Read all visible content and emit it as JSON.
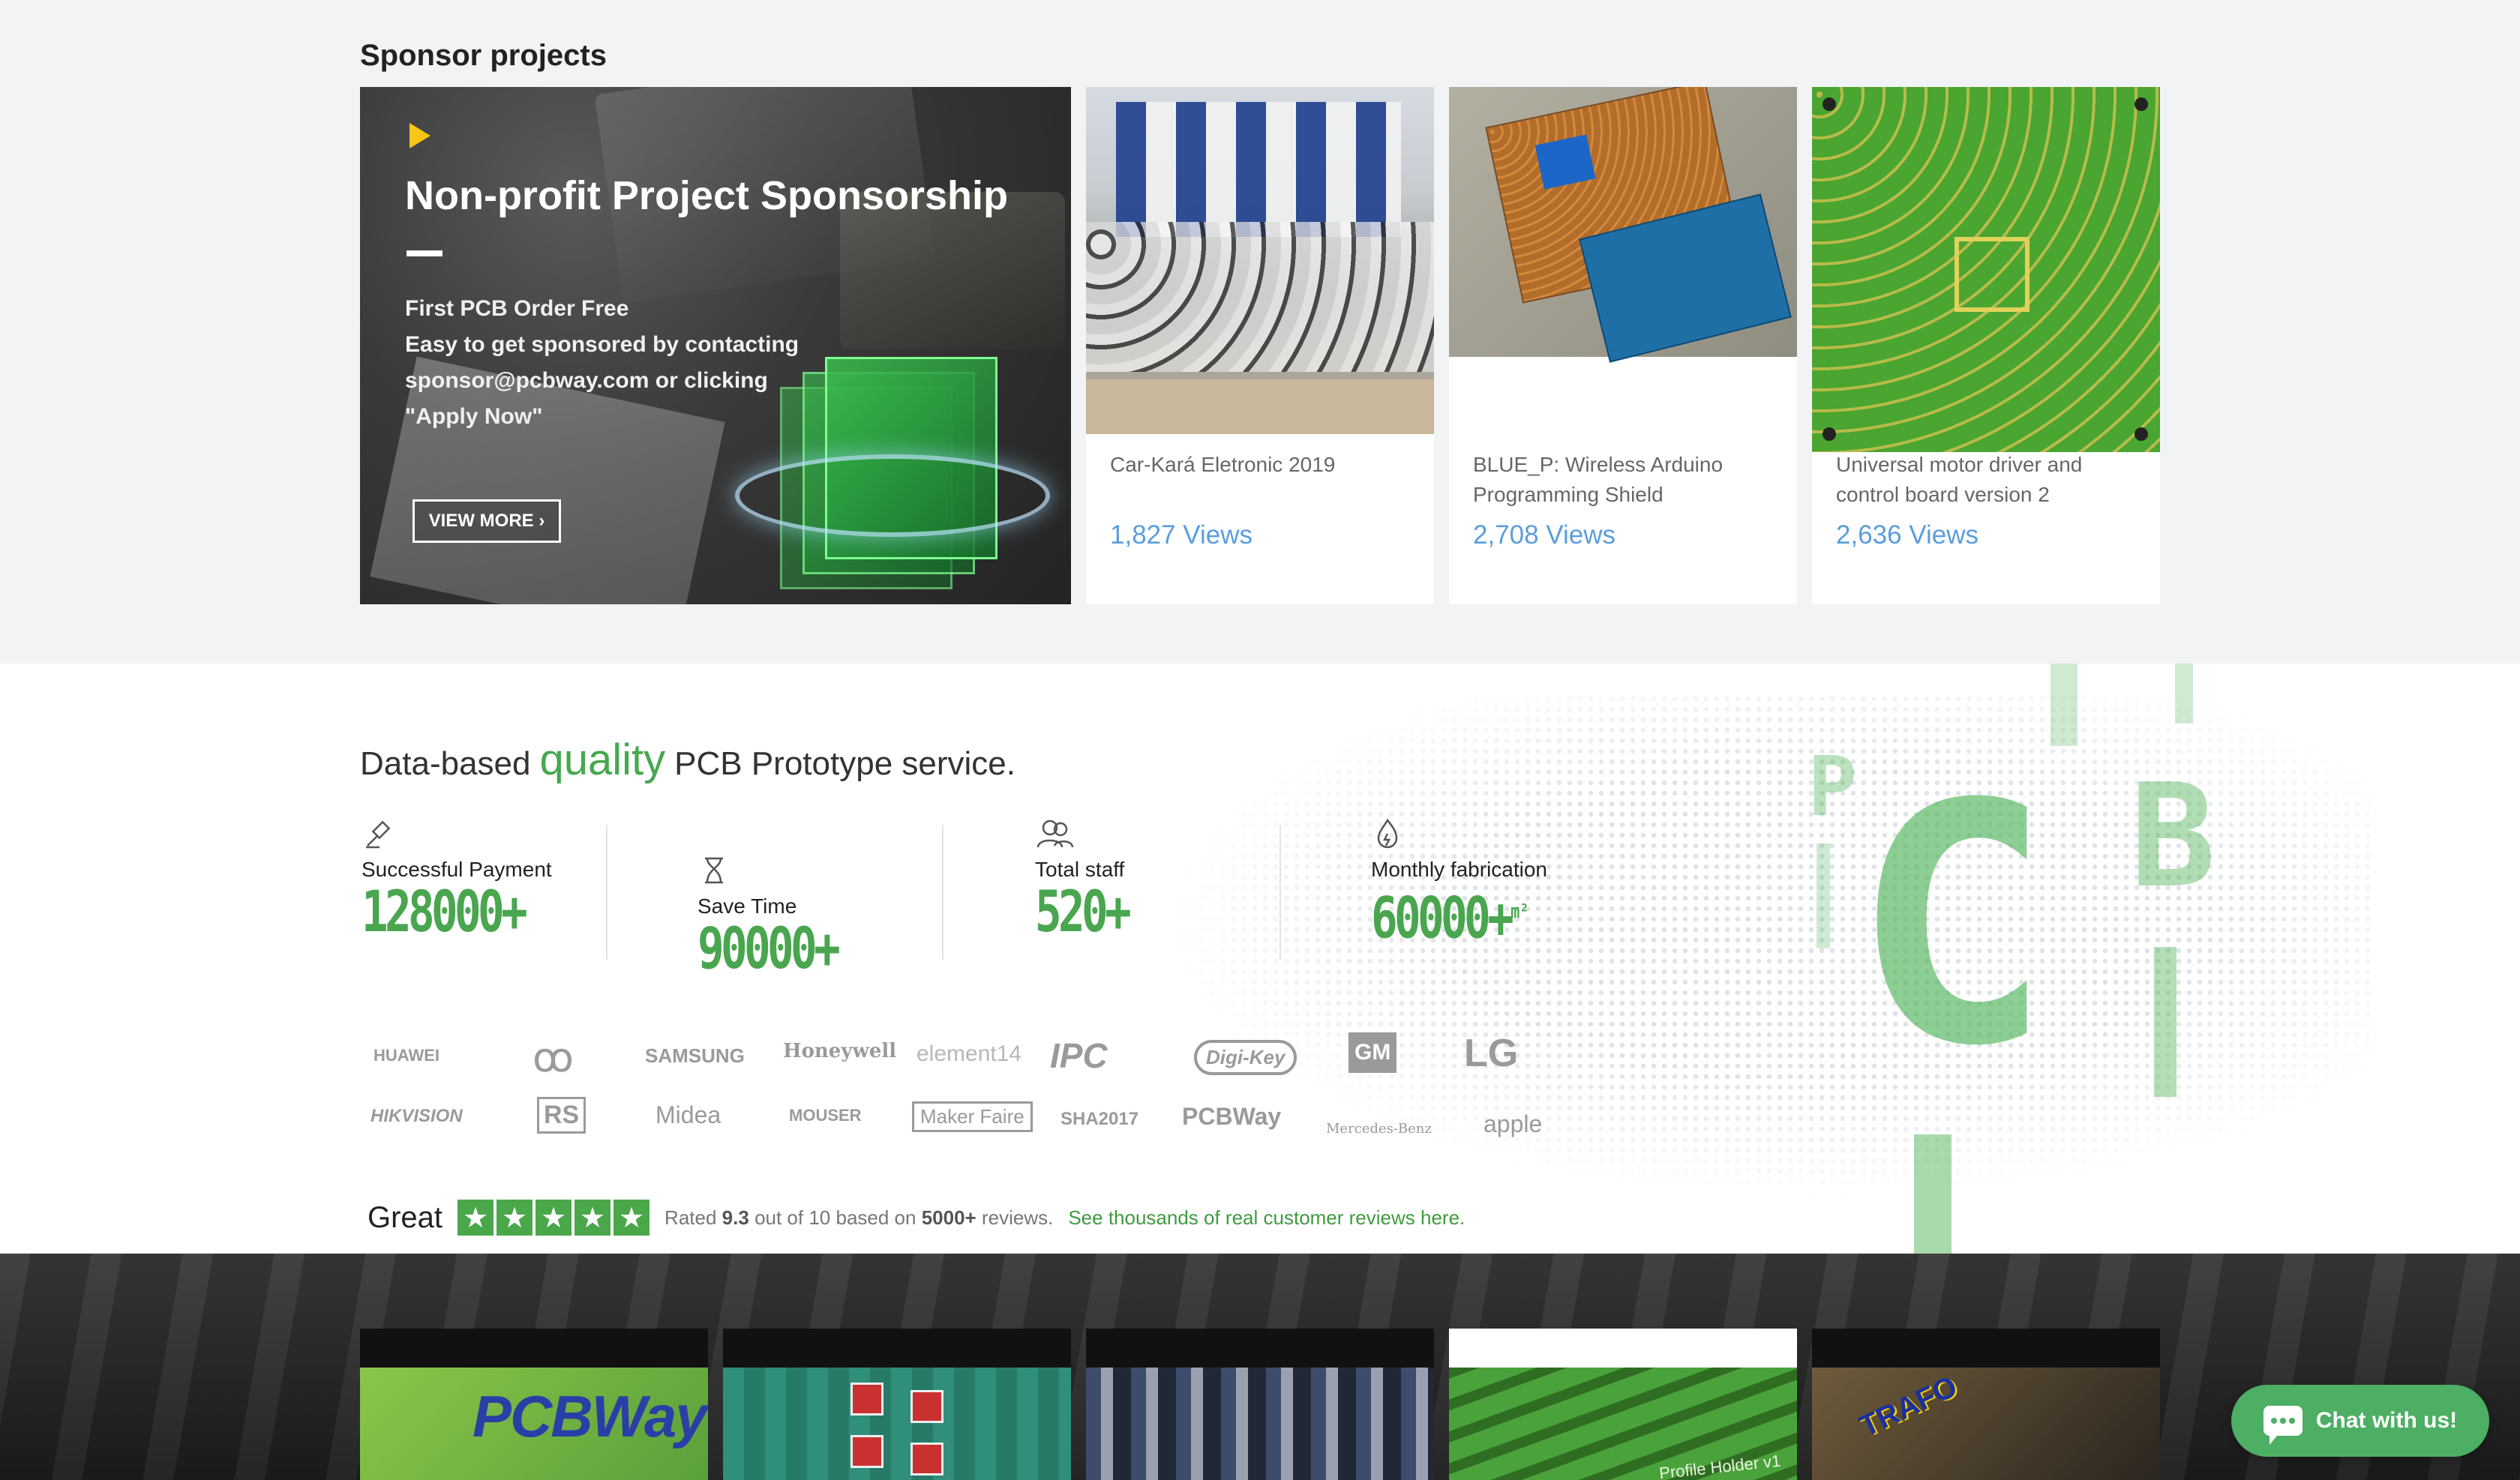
{
  "sponsor": {
    "title": "Sponsor projects",
    "hero": {
      "title": "Non-profit Project Sponsorship",
      "lines": [
        "First PCB Order Free",
        "Easy to get sponsored by contacting",
        "sponsor@pcbway.com or clicking",
        "\"Apply Now\""
      ],
      "button": "VIEW MORE ›"
    },
    "projects": [
      {
        "name": "Car-Kará Eletronic 2019",
        "views": "1,827 Views"
      },
      {
        "name": "BLUE_P: Wireless Arduino Programming Shield",
        "views": "2,708 Views"
      },
      {
        "name": "Universal motor driver and control board version 2",
        "views": "2,636 Views"
      }
    ]
  },
  "stats": {
    "headline_pre": "Data-based",
    "headline_quality": "quality",
    "headline_post": "PCB Prototype service.",
    "items": [
      {
        "label": "Successful Payment",
        "value": "128000+",
        "icon": "gavel-icon"
      },
      {
        "label": "Save Time",
        "value": "90000+",
        "icon": "hourglass-icon"
      },
      {
        "label": "Total staff",
        "value": "520+",
        "icon": "staff-icon"
      },
      {
        "label": "Monthly fabrication",
        "value": "60000+",
        "unit": "m²",
        "icon": "flame-icon"
      }
    ],
    "decor_letters": [
      "P",
      "C",
      "B"
    ]
  },
  "logos": {
    "row1": [
      "HUAWEI",
      "ꝏ",
      "SAMSUNG",
      "Honeywell",
      "element14",
      "IPC",
      "Digi-Key",
      "GM",
      "LG"
    ],
    "row2": [
      "HIKVISION",
      "RS",
      "Midea",
      "MOUSER",
      "Maker Faire",
      "SHA2017",
      "PCBWay",
      "Mercedes-Benz",
      "apple"
    ]
  },
  "review": {
    "rating_word": "Great",
    "text_pre": "Rated",
    "score": "9.3",
    "text_mid": "out of 10 based on",
    "count": "5000+",
    "text_post": "reviews.",
    "link": "See thousands of real customer reviews here."
  },
  "gallery": {
    "brand": "PCBWay",
    "g4_note": "Profile Holder v1",
    "g5_label": "TRAFO"
  },
  "chat": {
    "label": "Chat with us!"
  },
  "colors": {
    "accent_green": "#46a84f",
    "link_blue": "#5b9ddd",
    "chat_green": "#4caf63"
  }
}
